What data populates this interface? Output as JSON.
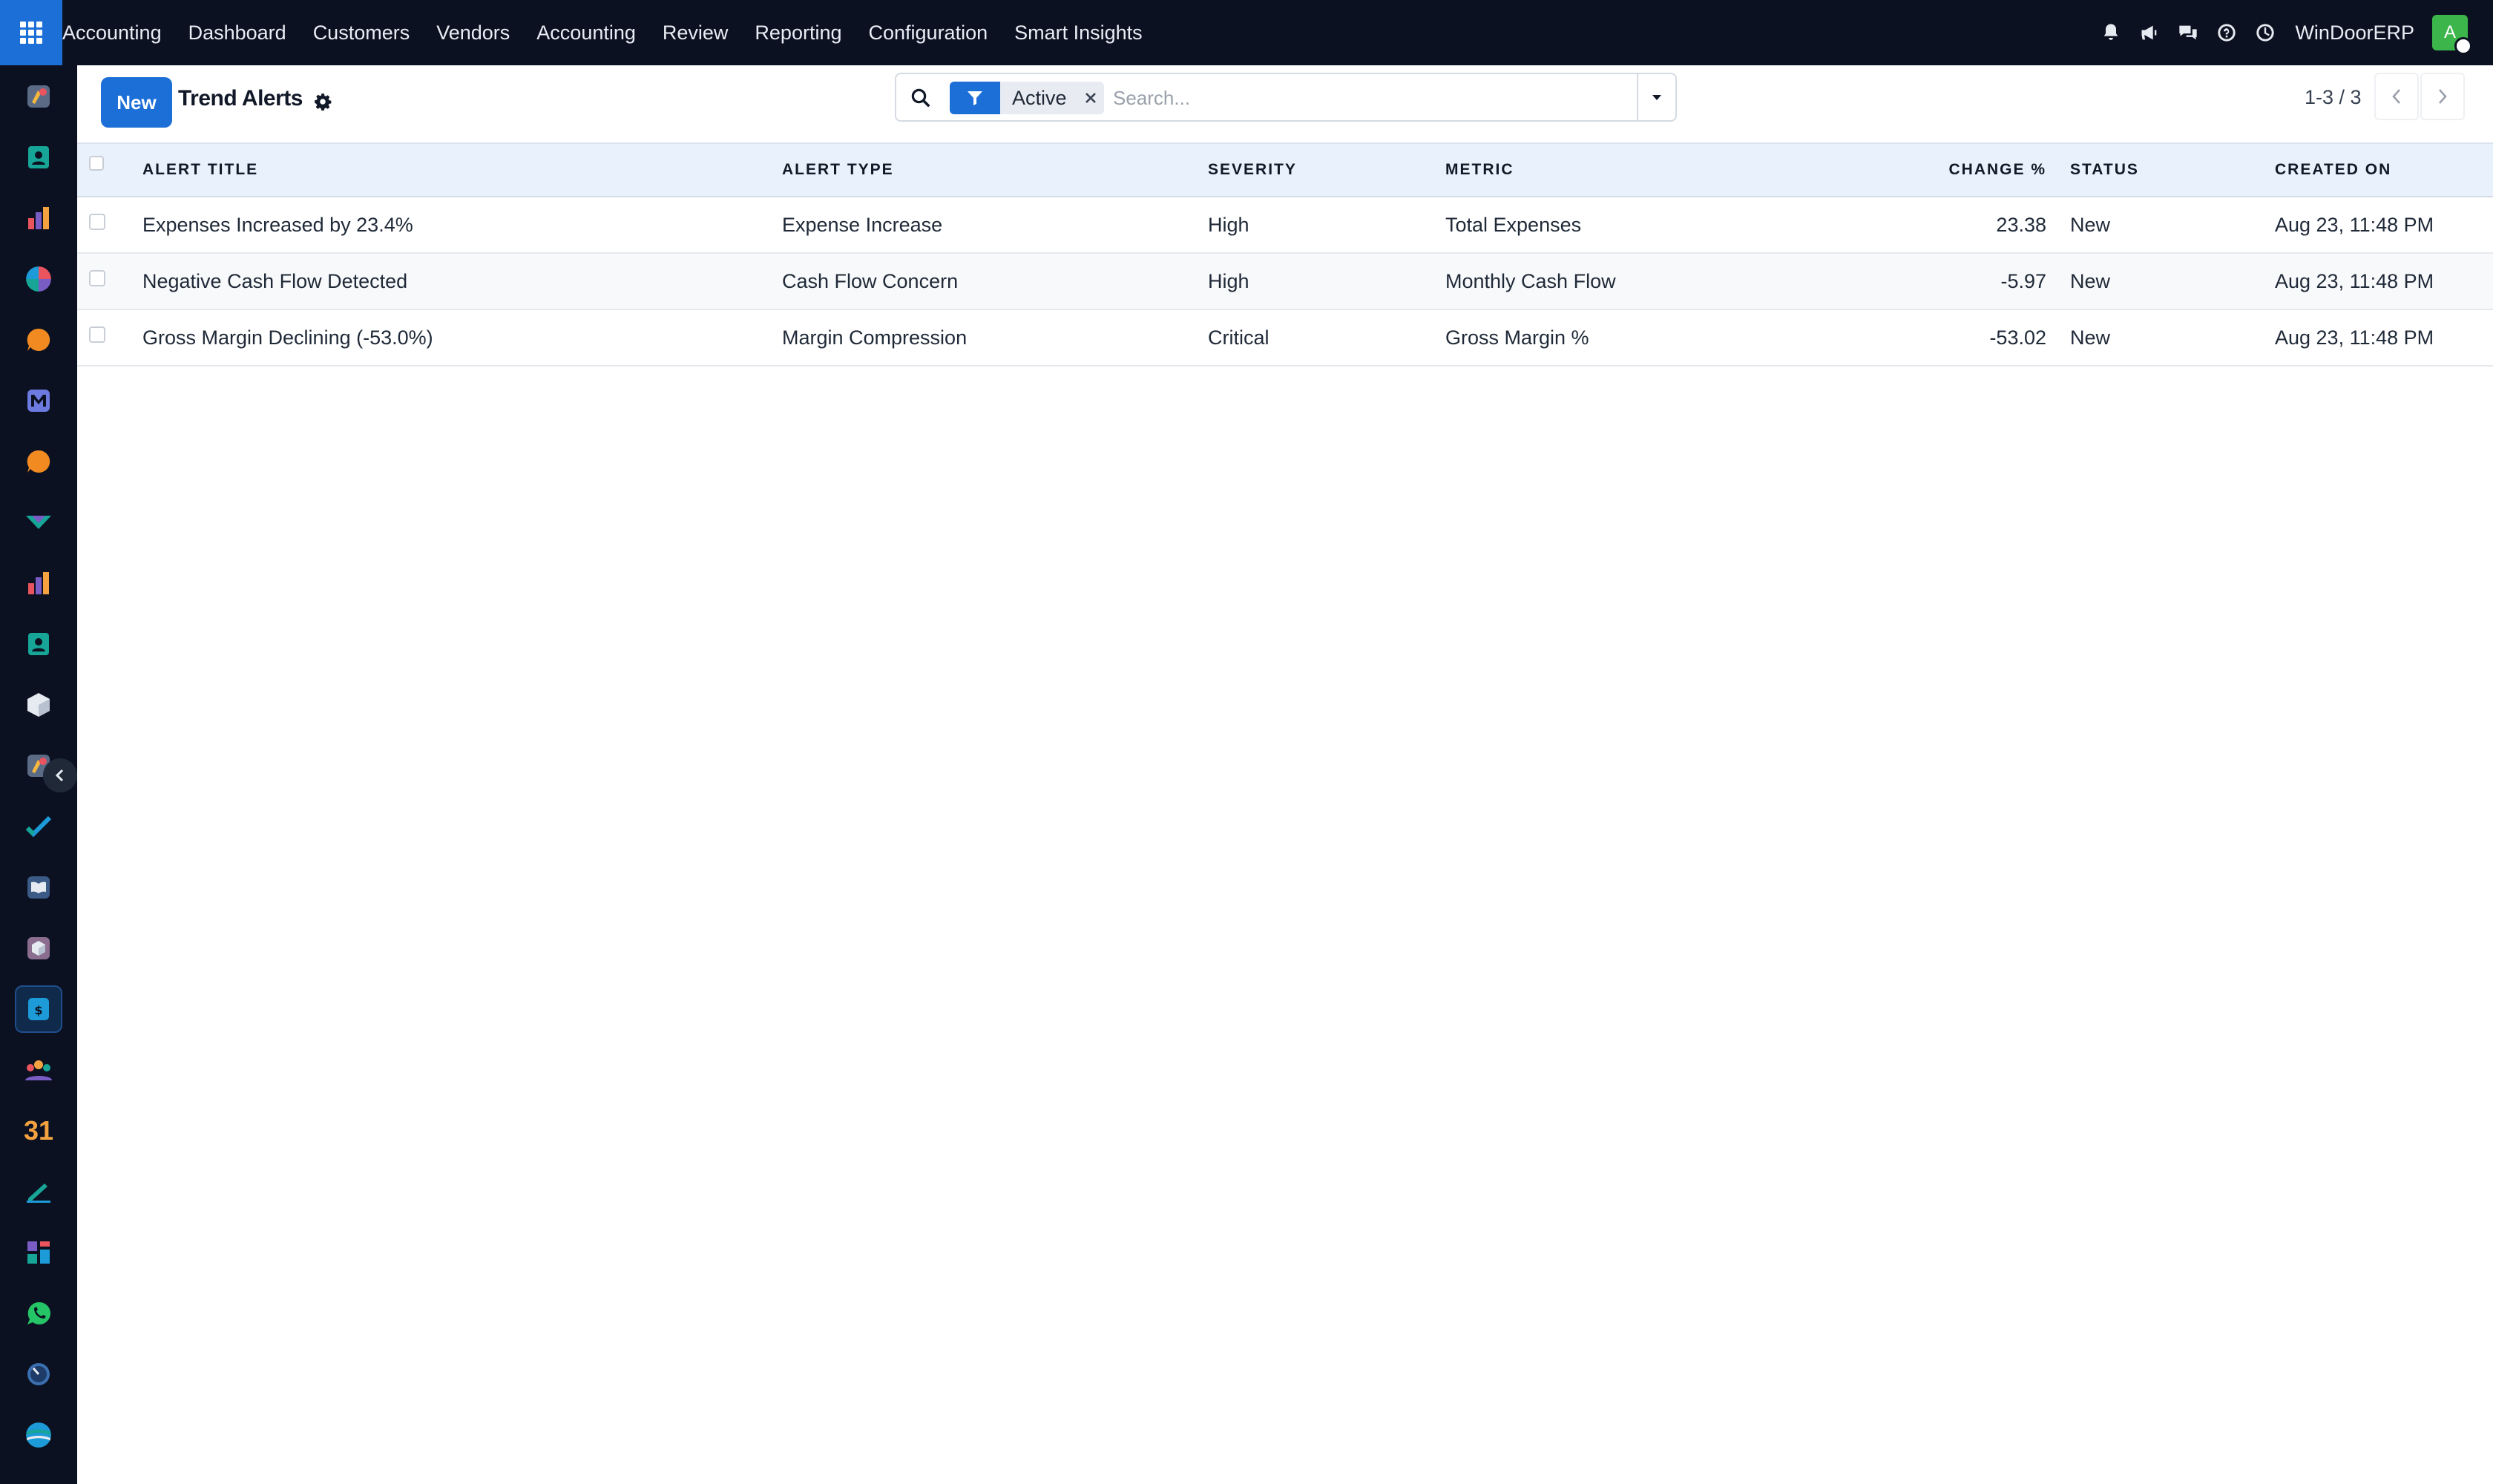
{
  "navbar": {
    "app_name": "Accounting",
    "menu": [
      "Dashboard",
      "Customers",
      "Vendors",
      "Accounting",
      "Review",
      "Reporting",
      "Configuration",
      "Smart Insights"
    ],
    "icons": [
      "bell-icon",
      "megaphone-icon",
      "chat-icon",
      "help-icon",
      "clock-icon"
    ],
    "company": "WinDoorERP",
    "avatar_initial": "A",
    "colors": {
      "bar": "#0b1120",
      "apps_button": "#1d6fd8",
      "avatar": "#3cb54a"
    }
  },
  "sidebar": {
    "apps": [
      {
        "icon": "discuss-app-icon"
      },
      {
        "icon": "contacts-app-icon"
      },
      {
        "icon": "reporting-bars-app-icon"
      },
      {
        "icon": "pie-app-icon"
      },
      {
        "icon": "livechat-app-icon"
      },
      {
        "icon": "email-marketing-app-icon"
      },
      {
        "icon": "chat-bubble-app-icon"
      },
      {
        "icon": "accounting-check-app-icon"
      },
      {
        "icon": "charts-app-icon"
      },
      {
        "icon": "employees-app-icon"
      },
      {
        "icon": "inventory-cube-app-icon"
      },
      {
        "icon": "studio-app-icon"
      },
      {
        "icon": "project-check-app-icon"
      },
      {
        "icon": "knowledge-book-app-icon"
      },
      {
        "icon": "packages-app-icon"
      },
      {
        "icon": "invoicing-app-icon",
        "active": true
      },
      {
        "icon": "team-app-icon"
      },
      {
        "icon": "calendar-app-icon",
        "text": "31"
      },
      {
        "icon": "sign-app-icon"
      },
      {
        "icon": "dashboard-tiles-app-icon"
      },
      {
        "icon": "whatsapp-app-icon"
      },
      {
        "icon": "timesheet-app-icon"
      },
      {
        "icon": "website-app-icon"
      }
    ]
  },
  "control_panel": {
    "new_label": "New",
    "title": "Trend Alerts",
    "facet_label": "Active",
    "search_placeholder": "Search...",
    "pager_value": "1-3 / 3"
  },
  "table": {
    "columns": [
      "ALERT TITLE",
      "ALERT TYPE",
      "SEVERITY",
      "METRIC",
      "CHANGE %",
      "STATUS",
      "CREATED ON"
    ],
    "rows": [
      {
        "title": "Expenses Increased by 23.4%",
        "type": "Expense Increase",
        "severity": "High",
        "metric": "Total Expenses",
        "change": "23.38",
        "status": "New",
        "created": "Aug 23, 11:48 PM"
      },
      {
        "title": "Negative Cash Flow Detected",
        "type": "Cash Flow Concern",
        "severity": "High",
        "metric": "Monthly Cash Flow",
        "change": "-5.97",
        "status": "New",
        "created": "Aug 23, 11:48 PM"
      },
      {
        "title": "Gross Margin Declining (-53.0%)",
        "type": "Margin Compression",
        "severity": "Critical",
        "metric": "Gross Margin %",
        "change": "-53.02",
        "status": "New",
        "created": "Aug 23, 11:48 PM"
      }
    ]
  }
}
